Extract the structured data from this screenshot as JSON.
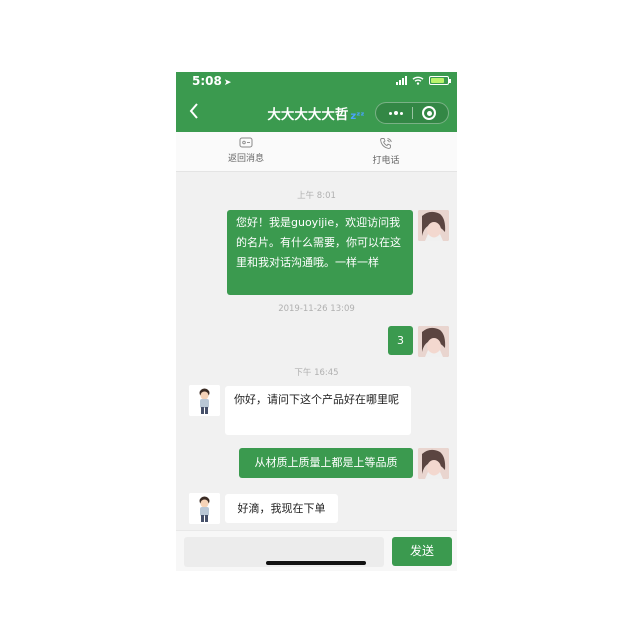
{
  "status_bar": {
    "time": "5:08",
    "location_arrow": "➤"
  },
  "nav": {
    "back_icon": "chevron-left",
    "title": "大大大大大哲",
    "title_emoji": "zᶻᶻ"
  },
  "toolbar": {
    "return_label": "返回消息",
    "call_label": "打电话"
  },
  "messages": [
    {
      "type": "time",
      "text": "上午 8:01"
    },
    {
      "type": "sent",
      "text": "您好！我是guoyijie，欢迎访问我的名片。有什么需要，你可以在这里和我对话沟通哦。一样一样"
    },
    {
      "type": "time",
      "text": "2019-11-26 13:09"
    },
    {
      "type": "sent",
      "text": "3"
    },
    {
      "type": "time",
      "text": "下午 16:45"
    },
    {
      "type": "received",
      "text": "你好，请问下这个产品好在哪里呢"
    },
    {
      "type": "sent",
      "text": "从材质上质量上都是上等品质"
    },
    {
      "type": "received",
      "text": "好滴，我现在下单"
    }
  ],
  "input": {
    "value": "",
    "send_label": "发送"
  },
  "colors": {
    "brand": "#3b9a4f",
    "background": "#f1f1f1"
  }
}
